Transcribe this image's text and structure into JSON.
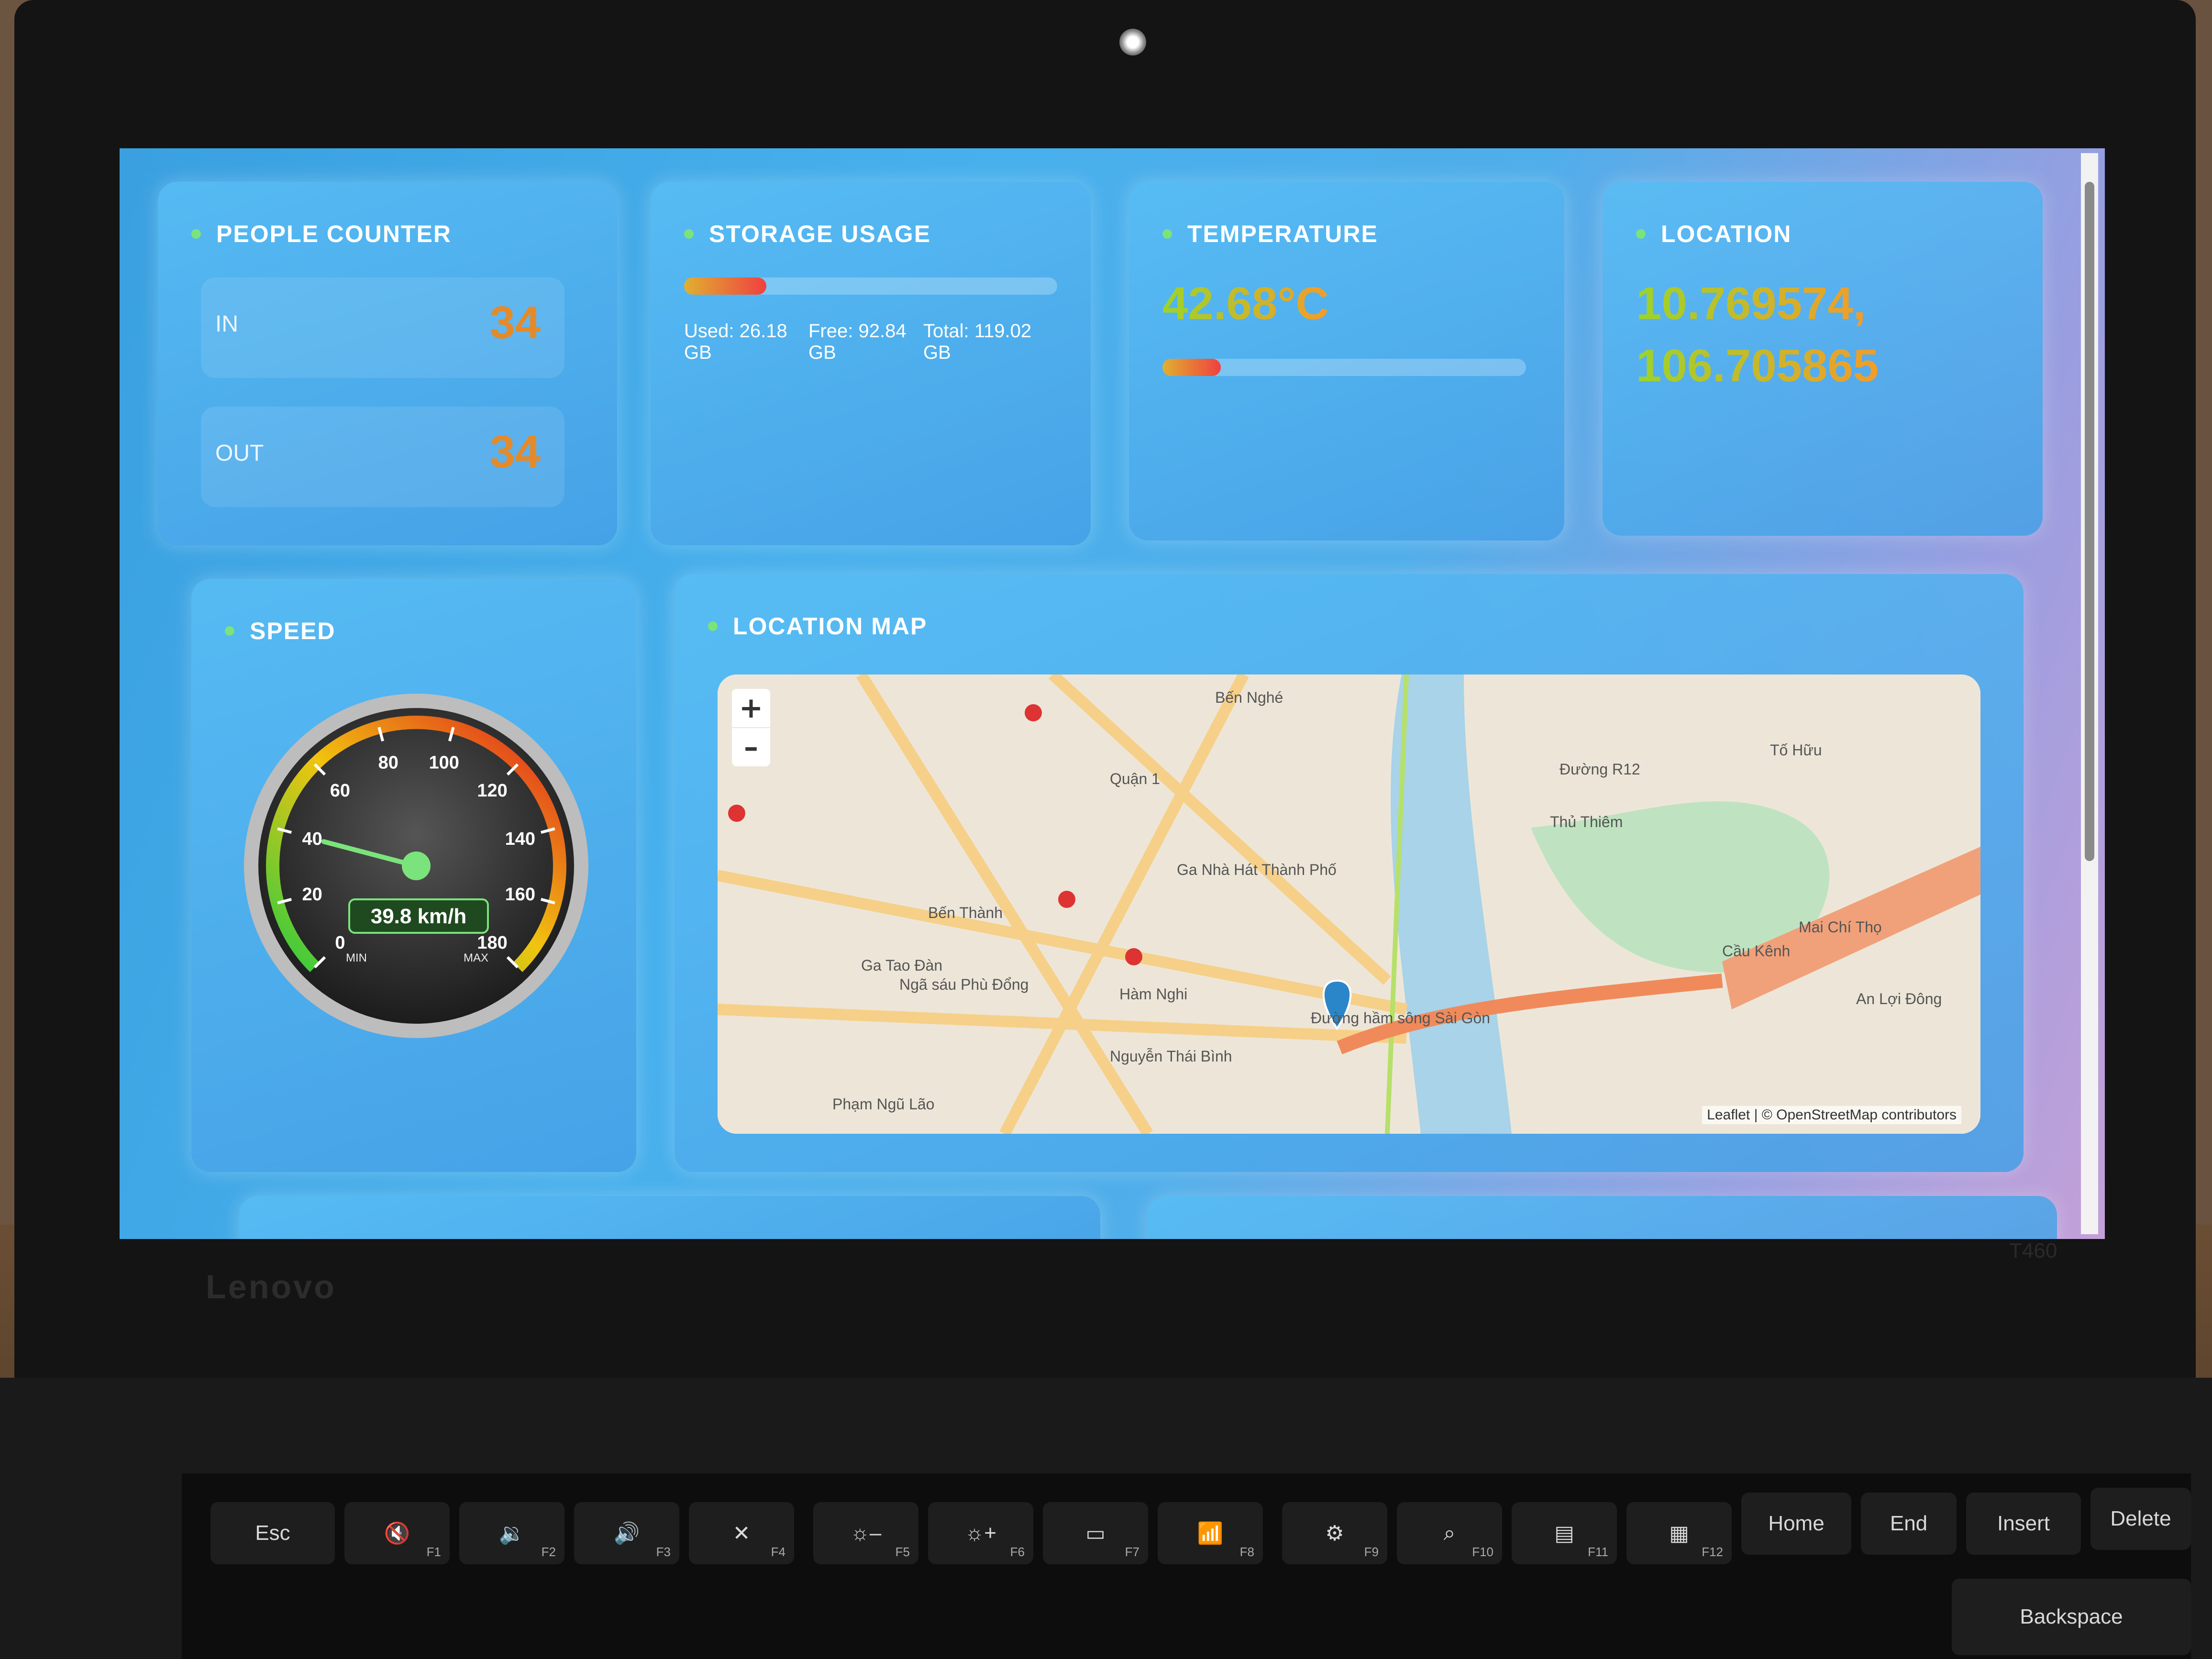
{
  "cards": {
    "people_counter": {
      "title": "PEOPLE COUNTER",
      "in_label": "IN",
      "in_value": "34",
      "out_label": "OUT",
      "out_value": "34"
    },
    "storage": {
      "title": "STORAGE USAGE",
      "used": "Used: 26.18 GB",
      "free": "Free: 92.84 GB",
      "total": "Total: 119.02 GB",
      "used_fraction": 0.22
    },
    "temperature": {
      "title": "TEMPERATURE",
      "value": "42.68°C",
      "fraction": 0.16
    },
    "location": {
      "title": "LOCATION",
      "lat": "10.769574,",
      "lon": "106.705865"
    },
    "speed": {
      "title": "SPEED",
      "value_label": "39.8 km/h",
      "value": 39.8,
      "min_label": "MIN",
      "max_label": "MAX",
      "ticks": [
        "0",
        "20",
        "40",
        "60",
        "80",
        "100",
        "120",
        "140",
        "160",
        "180"
      ]
    },
    "map": {
      "title": "LOCATION MAP",
      "zoom_in": "+",
      "zoom_out": "–",
      "attribution": "Leaflet | © OpenStreetMap contributors",
      "labels": [
        "Bến Nghé",
        "Quận 1",
        "Thủ Thiêm",
        "Ga Nhà Hát Thành Phố",
        "Bến Thành",
        "Ga Tao Đàn",
        "Ngã sáu Phù Đổng",
        "Hàm Nghi",
        "Nguyễn Thái Bình",
        "Phạm Ngũ Lão",
        "Đường hầm sông Sài Gòn",
        "An Lợi Đông",
        "Cầu Kênh",
        "Mai Chí Thọ",
        "Đường R12",
        "Tố Hữu"
      ]
    },
    "brand": "Lenovo",
    "model": "T460"
  }
}
